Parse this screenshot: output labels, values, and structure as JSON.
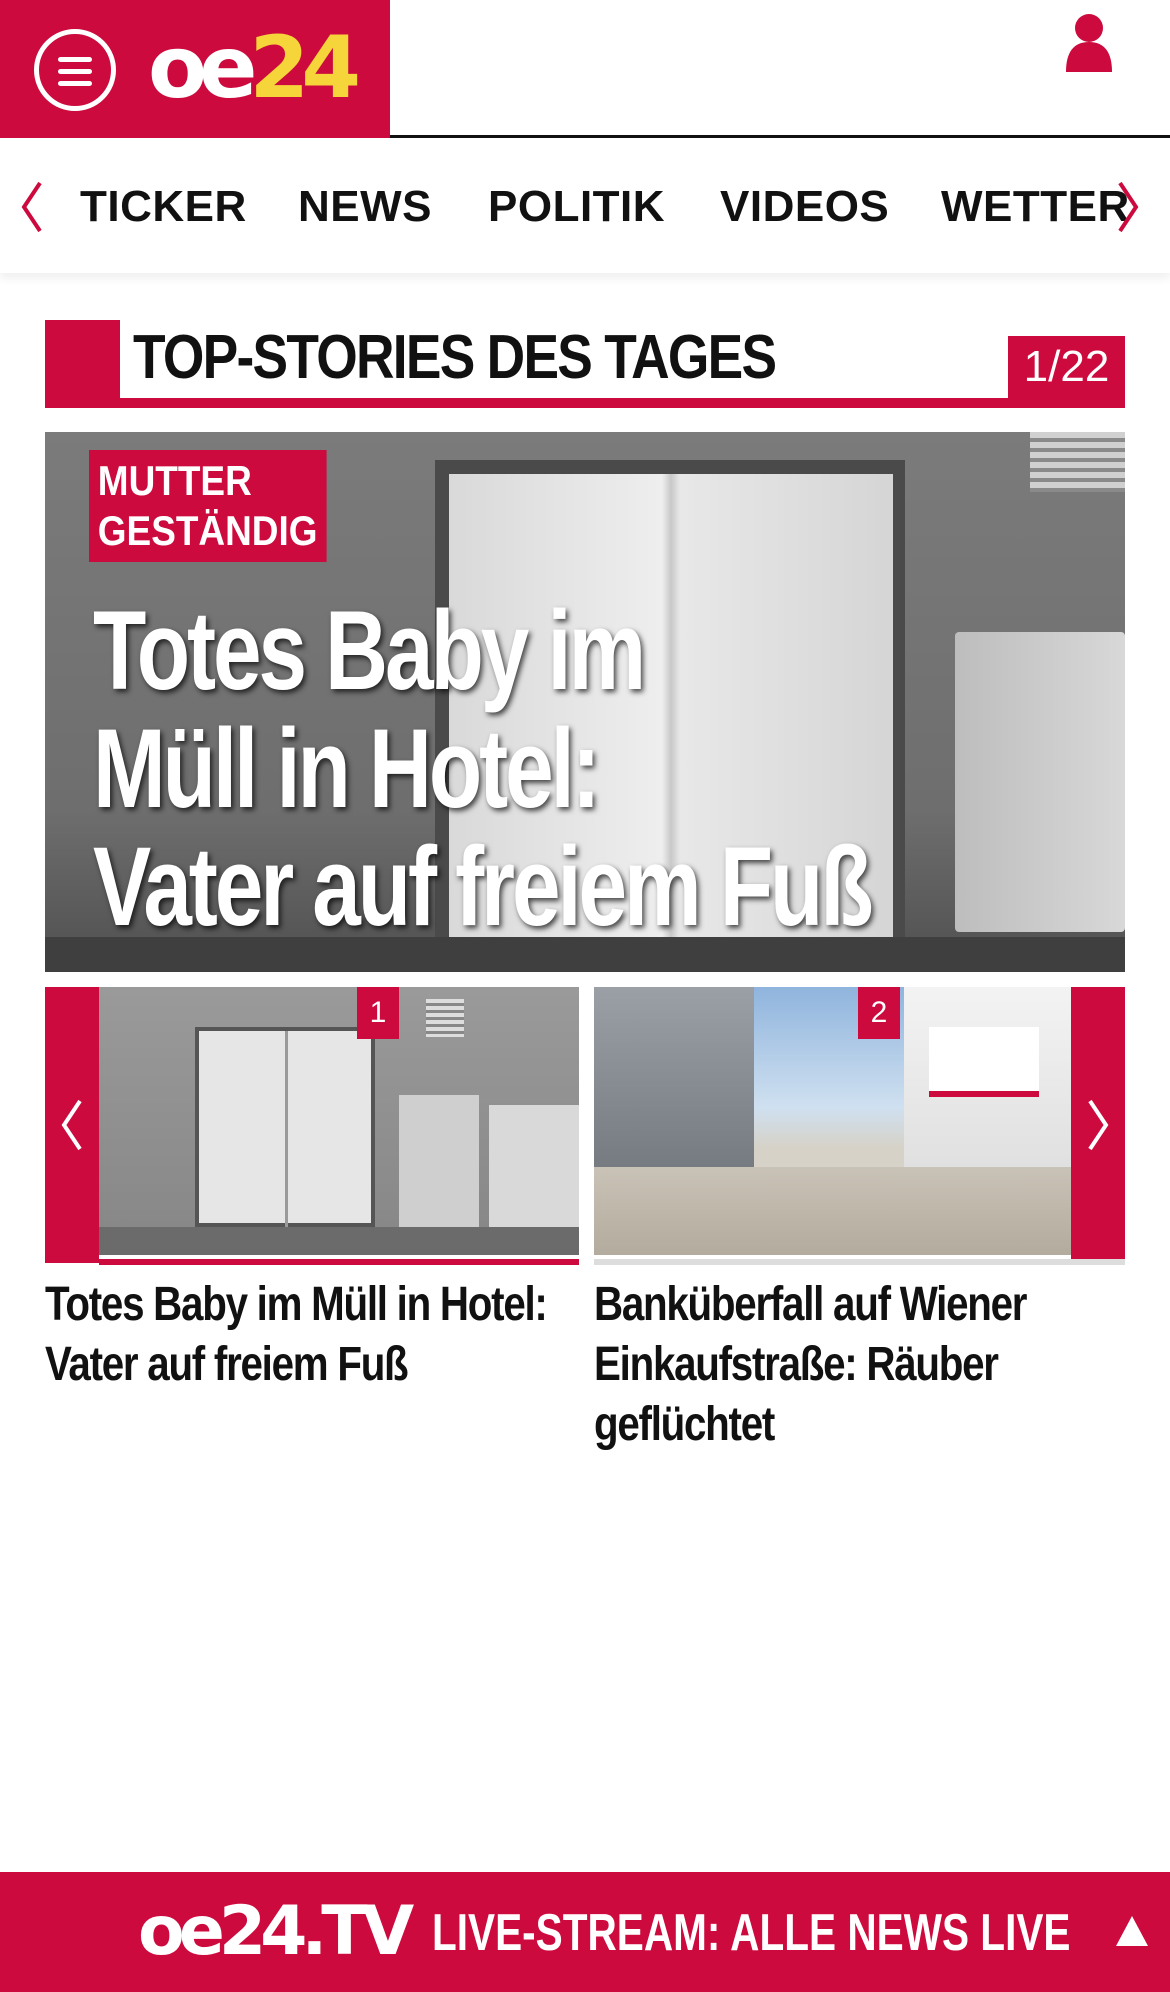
{
  "header": {
    "logo_main": "oe",
    "logo_num": "24",
    "menu_icon": "hamburger-menu-icon",
    "user_icon": "user-icon"
  },
  "nav": {
    "items": [
      "TICKER",
      "NEWS",
      "POLITIK",
      "VIDEOS",
      "WETTER"
    ]
  },
  "section": {
    "title": "TOP-STORIES DES TAGES",
    "counter": "1/22"
  },
  "hero": {
    "kicker_lines": [
      "MUTTER",
      "GESTÄNDIG"
    ],
    "headline_lines": [
      "Totes Baby im",
      "Müll in Hotel:",
      "Vater auf freiem Fuß"
    ]
  },
  "carousel": {
    "cards": [
      {
        "badge": "1",
        "title_lines": [
          "Totes Baby im Müll in Hotel:",
          "Vater auf freiem Fuß"
        ]
      },
      {
        "badge": "2",
        "title_lines": [
          "Banküberfall auf Wiener",
          "Einkaufstraße: Räuber",
          "geflüchtet"
        ]
      }
    ]
  },
  "live_bar": {
    "logo": "oe24.TV",
    "text": "LIVE-STREAM:  ALLE NEWS LIVE"
  },
  "colors": {
    "brand_red": "#cc0a3d",
    "logo_yellow": "#f5d53a"
  }
}
